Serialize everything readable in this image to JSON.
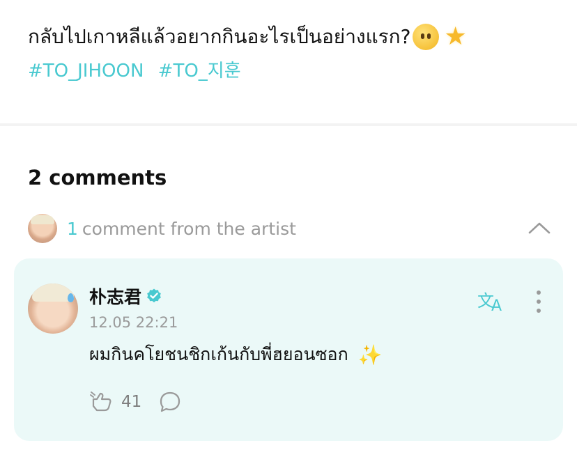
{
  "post": {
    "text": "กลับไปเกาหลีแล้วอยากกินอะไรเป็นอย่างแรก?",
    "emoji_1": "face-without-mouth-emoji",
    "emoji_2": "glowing-star-emoji",
    "hashtags": [
      "#TO_JIHOON",
      "#TO_지훈"
    ]
  },
  "comments": {
    "title": "2 comments",
    "artist_summary": {
      "count": "1",
      "label": "comment from the artist",
      "toggle_icon": "chevron-up-icon"
    },
    "items": [
      {
        "author": "朴志君",
        "verified_icon": "verified-badge-icon",
        "timestamp": "12.05 22:21",
        "text": "ผมกินคโยชนชิกเก้นกับพี่ฮยอนซอก",
        "emoji": "sparkles-emoji",
        "likes": "41",
        "like_icon": "like-icon",
        "reply_icon": "reply-icon",
        "translate_icon": "translate-icon",
        "more_icon": "more-icon"
      }
    ]
  },
  "colors": {
    "accent": "#49c9d0",
    "card_background": "#ebf9f8",
    "muted_text": "#9a9a9a"
  }
}
